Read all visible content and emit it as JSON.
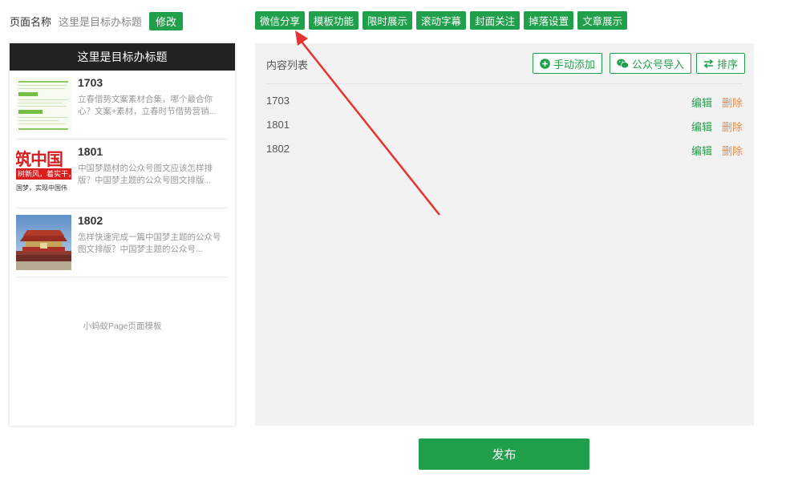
{
  "header": {
    "page_name_label": "页面名称",
    "page_name_value": "这里是目标办标题",
    "edit_button": "修改"
  },
  "function_tabs": [
    "微信分享",
    "模板功能",
    "限时展示",
    "滚动字幕",
    "封面关注",
    "掉落设置",
    "文章展示"
  ],
  "preview": {
    "header_title": "这里是目标办标题",
    "articles": [
      {
        "title": "1703",
        "desc": "立春借势文案素材合集，哪个最合你心？文案+素材，立春时节借势营销..."
      },
      {
        "title": "1801",
        "desc": "中国梦题材的公众号图文应该怎样排版？中国梦主题的公众号图文排版..."
      },
      {
        "title": "1802",
        "desc": "怎样快速完成一篇中国梦主题的公众号图文排版？中国梦主题的公众号..."
      }
    ],
    "thumb2": {
      "big_text": "筑中国",
      "bar_text": "树新风，着实干，",
      "bottom_text": "国梦，实现中国伟"
    },
    "footer": "小蚂蚁Page页面模板"
  },
  "content": {
    "title": "内容列表",
    "buttons": {
      "manual_add": "手动添加",
      "wechat_import": "公众号导入",
      "sort": "排序"
    },
    "rows": [
      {
        "title": "1703",
        "edit": "编辑",
        "delete": "删除"
      },
      {
        "title": "1801",
        "edit": "编辑",
        "delete": "删除"
      },
      {
        "title": "1802",
        "edit": "编辑",
        "delete": "删除"
      }
    ]
  },
  "publish_label": "发布",
  "colors": {
    "accent": "#21a04b",
    "delete": "#f08a3e",
    "preview_header": "#222222",
    "panel_bg": "#f2f2f2",
    "annotation_arrow": "#e8322f"
  },
  "icons": {
    "manual_add": "plus-circle-icon",
    "wechat_import": "wechat-icon",
    "sort": "swap-arrows-icon",
    "annotation": "red-arrow-icon"
  }
}
